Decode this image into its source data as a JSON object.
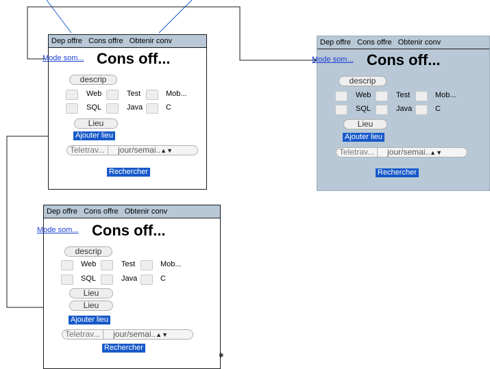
{
  "tabs": [
    "Dep offre",
    "Cons offre",
    "Obtenir conv"
  ],
  "mode_link": "Mode som...",
  "page_title": "Cons off...",
  "description_placeholder": "descrip",
  "checkbox_labels": [
    "Web",
    "Test",
    "Mob...",
    "SQL",
    "Java",
    "C"
  ],
  "location_placeholder": "Lieu",
  "add_location_button": "Ajouter lieu",
  "remote_select": {
    "left": "Teletrav...",
    "right": "jour/semai.."
  },
  "remote_arrow_icon": "updown-arrows-icon",
  "search_button": "Rechercher",
  "cursor_icon": "mouse-cursor-icon",
  "colors": {
    "tabbar": "#b8c8d6",
    "button": "#1759c9",
    "link": "#1a3fd6",
    "greyed_frame": "#b8c8d6"
  }
}
